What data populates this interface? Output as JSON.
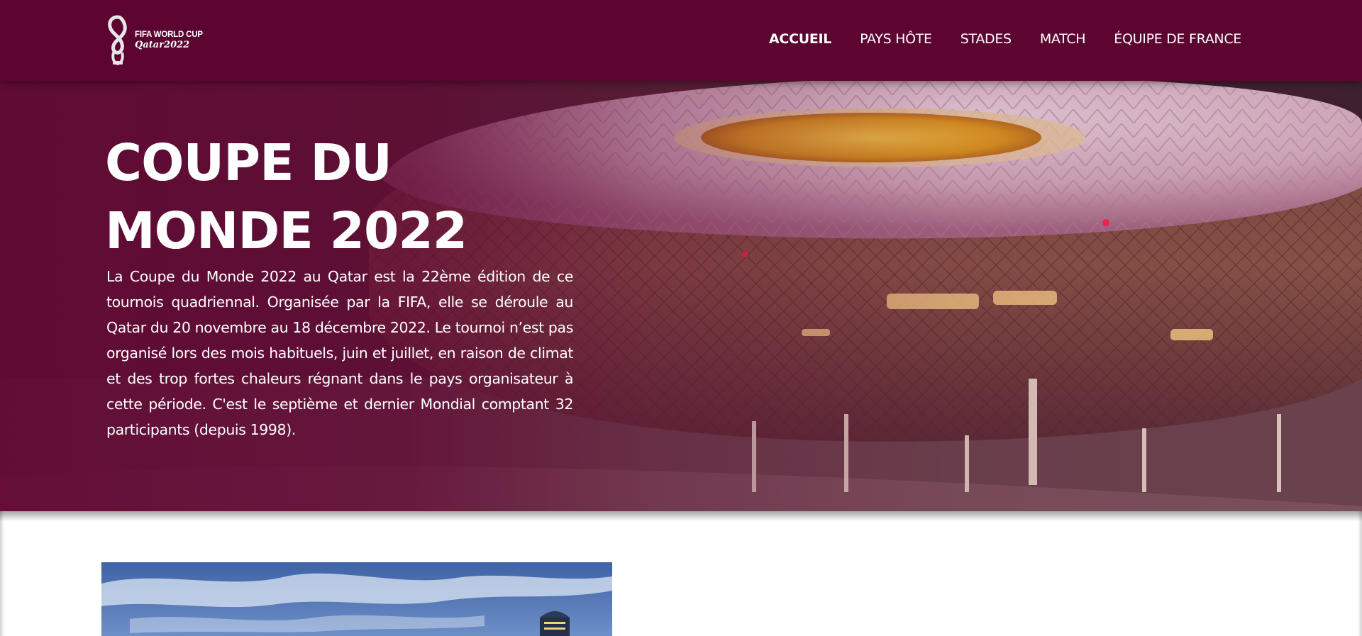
{
  "header": {
    "logo": {
      "line1": "FIFA WORLD CUP",
      "line2": "Qatar2022"
    },
    "nav": [
      {
        "label": "ACCUEIL",
        "active": true
      },
      {
        "label": "PAYS HÔTE",
        "active": false
      },
      {
        "label": "STADES",
        "active": false
      },
      {
        "label": "MATCH",
        "active": false
      },
      {
        "label": "ÉQUIPE DE FRANCE",
        "active": false
      }
    ]
  },
  "hero": {
    "title_line1": "COUPE DU",
    "title_line2": "MONDE 2022",
    "text": "La Coupe du Monde 2022 au Qatar est la 22ème édition de ce tournois quadriennal. Organisée par la FIFA, elle se déroule au Qatar du 20 novembre au 18 décembre 2022. Le tournoi n’est pas organisé lors des mois habituels, juin et juillet, en raison de climat et des trop fortes chaleurs régnant dans le pays organisateur à cette période. C'est le septième et dernier Mondial comptant 32 participants (depuis 1998)."
  },
  "colors": {
    "brand": "#5b0530",
    "overlay": "#620834",
    "text": "#ffffff"
  },
  "icons": {
    "logo": "fifa-trophy-icon"
  }
}
